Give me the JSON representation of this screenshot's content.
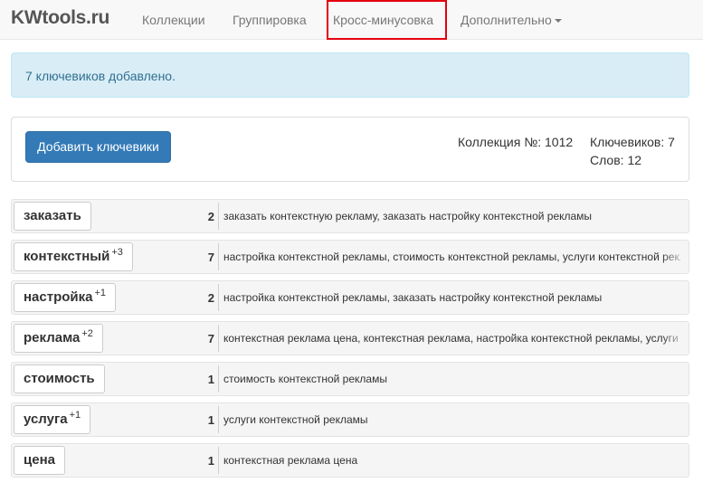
{
  "navbar": {
    "brand": "KWtools.ru",
    "links": [
      "Коллекции",
      "Группировка",
      "Кросс-минусовка",
      "Дополнительно"
    ]
  },
  "alert": {
    "text": "7 ключевиков добавлено."
  },
  "panel": {
    "add_button": "Добавить ключевики",
    "collection": "Коллекция №: 1012",
    "keywords": "Ключевиков: 7",
    "words": "Слов: 12"
  },
  "words": [
    {
      "word": "заказать",
      "extra": "",
      "count": "2",
      "phrases": "заказать контекстную рекламу, заказать настройку контекстной рекламы"
    },
    {
      "word": "контекстный",
      "extra": "+3",
      "count": "7",
      "phrases": "настройка контекстной рекламы, стоимость контекстной рекламы, услуги контекстной рекламы"
    },
    {
      "word": "настройка",
      "extra": "+1",
      "count": "2",
      "phrases": "настройка контекстной рекламы, заказать настройку контекстной рекламы"
    },
    {
      "word": "реклама",
      "extra": "+2",
      "count": "7",
      "phrases": "контекстная реклама цена, контекстная реклама, настройка контекстной рекламы, услуги"
    },
    {
      "word": "стоимость",
      "extra": "",
      "count": "1",
      "phrases": "стоимость контекстной рекламы"
    },
    {
      "word": "услуга",
      "extra": "+1",
      "count": "1",
      "phrases": "услуги контекстной рекламы"
    },
    {
      "word": "цена",
      "extra": "",
      "count": "1",
      "phrases": "контекстная реклама цена"
    }
  ],
  "colors": {
    "primary": "#337ab7",
    "alert_bg": "#d9edf7",
    "alert_text": "#31708f",
    "highlight": "#e4000f"
  }
}
